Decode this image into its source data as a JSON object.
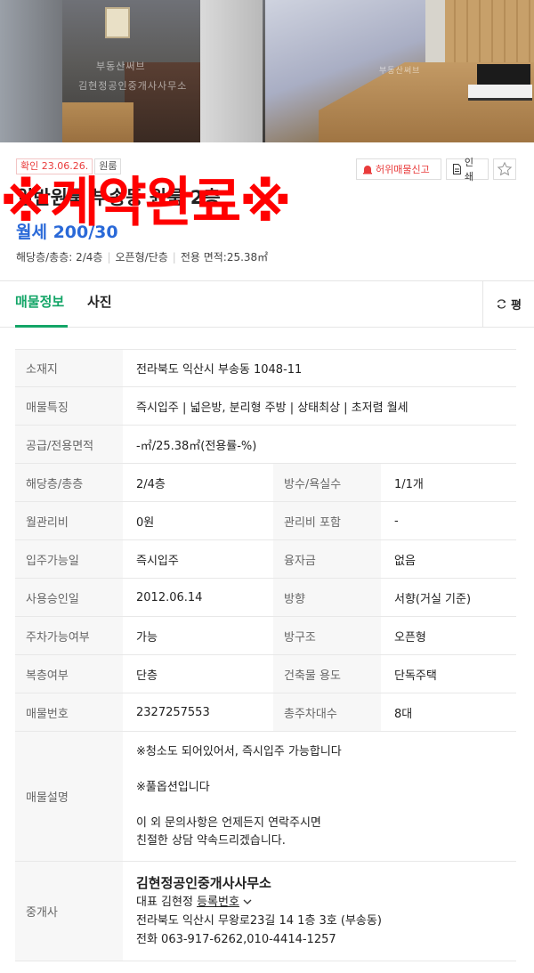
{
  "photos": {
    "watermark_1": "김현정공인중개사사무소",
    "watermark_2": "부동산써브"
  },
  "header": {
    "badge_confirm": "확인 23.06.26.",
    "badge_type": "원룸",
    "report_label": "허위매물신고",
    "print_label": "인쇄",
    "title": "일반원룸 부송동 원룸 2층",
    "price": "월세 200/30",
    "meta": [
      "해당층/총층: 2/4층",
      "오픈형/단층",
      "전용 면적:25.38㎡"
    ]
  },
  "stamp": "※계약완료※",
  "tabs": {
    "info": "매물정보",
    "photo": "사진",
    "right_label": "평"
  },
  "table": {
    "location_label": "소재지",
    "location_value": "전라북도 익산시 부송동 1048-11",
    "feature_label": "매물특징",
    "feature_value": "즉시입주 | 넓은방, 분리형 주방 | 상태최상 | 초저렴 월세",
    "area_label": "공급/전용면적",
    "area_value": "-㎡/25.38㎡(전용률-%)",
    "floor_label": "해당층/총층",
    "floor_value": "2/4층",
    "rooms_label": "방수/욕실수",
    "rooms_value": "1/1개",
    "fee_label": "월관리비",
    "fee_value": "0원",
    "fee_incl_label": "관리비 포함",
    "fee_incl_value": "-",
    "movein_label": "입주가능일",
    "movein_value": "즉시입주",
    "loan_label": "융자금",
    "loan_value": "없음",
    "approval_label": "사용승인일",
    "approval_value": "2012.06.14",
    "direction_label": "방향",
    "direction_value": "서향(거실 기준)",
    "parking_label": "주차가능여부",
    "parking_value": "가능",
    "structure_label": "방구조",
    "structure_value": "오픈형",
    "duplex_label": "복층여부",
    "duplex_value": "단층",
    "usage_label": "건축물 용도",
    "usage_value": "단독주택",
    "number_label": "매물번호",
    "number_value": "2327257553",
    "total_parking_label": "총주차대수",
    "total_parking_value": "8대",
    "desc_label": "매물설명",
    "desc_lines": [
      "※청소도 되어있어서, 즉시입주 가능합니다",
      "※풀옵션입니다",
      "이 외 문의사항은 언제든지 연락주시면",
      "친절한 상담 약속드리겠습니다."
    ],
    "broker_label": "중개사",
    "broker_name": "김현정공인중개사사무소",
    "broker_rep_prefix": "대표 김현정",
    "broker_reg_link": "등록번호",
    "broker_address": "전라북도 익산시 무왕로23길 14 1층 3호 (부송동)",
    "broker_phone": "전화 063-917-6262,010-4414-1257"
  }
}
